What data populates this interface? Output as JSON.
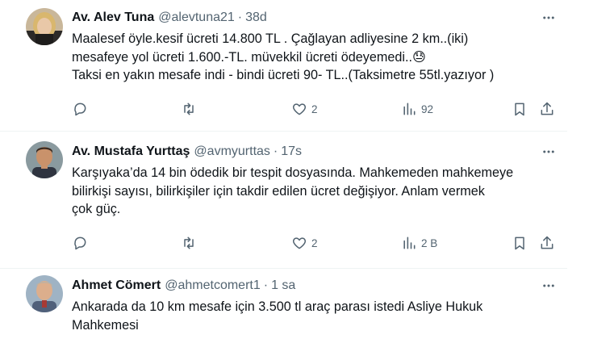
{
  "tweets": [
    {
      "name": "Av. Alev Tuna",
      "handle": "@alevtuna21",
      "separator": "·",
      "time": "38d",
      "lines": [
        "Maalesef öyle.kesif ücreti 14.800 TL . Çağlayan adliyesine 2 km..(iki)",
        "mesafeye yol ücreti 1.600.-TL. müvekkil ücreti ödeyemedi..",
        "Taksi en yakın mesafe indi - bindi ücreti 90- TL..(Taksimetre 55tl.yazıyor  )"
      ],
      "emoji": "😓",
      "likes": "2",
      "views": "92",
      "icons": {
        "reply": "reply-icon",
        "retweet": "retweet-icon",
        "like": "heart-icon",
        "views": "views-chart-icon",
        "bookmark": "bookmark-icon",
        "share": "share-icon",
        "more": "more-dots-icon"
      }
    },
    {
      "name": "Av. Mustafa Yurttaş",
      "handle": "@avmyurttas",
      "separator": "·",
      "time": "17s",
      "lines": [
        "Karşıyaka’da 14 bin ödedik bir tespit dosyasında. Mahkemeden mahkemeye",
        "bilirkişi sayısı, bilirkişiler için takdir edilen ücret değişiyor. Anlam vermek",
        "çok güç."
      ],
      "likes": "2",
      "views": "2 B"
    },
    {
      "name": "Ahmet Cömert",
      "handle": "@ahmetcomert1",
      "separator": "·",
      "time": "1 sa",
      "lines": [
        "Ankarada da 10 km mesafe için 3.500 tl araç parası istedi Asliye Hukuk",
        "Mahkemesi"
      ]
    }
  ],
  "colors": {
    "text": "#0f1419",
    "secondary": "#536471",
    "divider": "#eff3f4"
  }
}
